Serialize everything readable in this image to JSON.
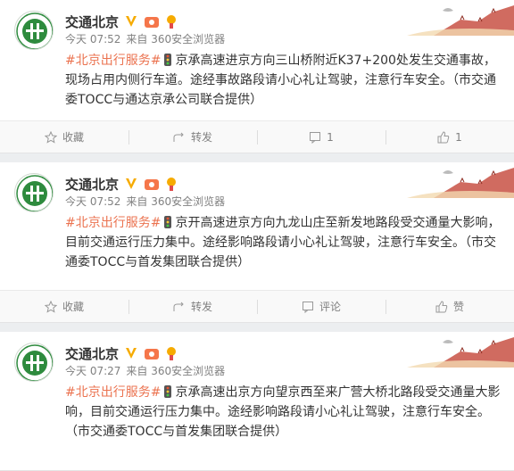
{
  "colors": {
    "accent": "#eb7350",
    "meta": "#808080",
    "verified": "#f6ab00",
    "logo_green": "#2e8b3e"
  },
  "posts": [
    {
      "author": "交通北京",
      "time": "今天 07:52",
      "source": "来自 360安全浏览器",
      "tag": "#北京出行服务#",
      "body": "京承高速进京方向三山桥附近K37+200处发生交通事故，现场占用内侧行车道。途经事故路段请小心礼让驾驶，注意行车安全。（市交通委TOCC与通达京承公司联合提供）",
      "actions": {
        "favorite": "收藏",
        "repost": "转发",
        "comment": "1",
        "like": "1"
      }
    },
    {
      "author": "交通北京",
      "time": "今天 07:52",
      "source": "来自 360安全浏览器",
      "tag": "#北京出行服务#",
      "body": "京开高速进京方向九龙山庄至新发地路段受交通量大影响，目前交通运行压力集中。途经影响路段请小心礼让驾驶，注意行车安全。（市交通委TOCC与首发集团联合提供）",
      "actions": {
        "favorite": "收藏",
        "repost": "转发",
        "comment": "评论",
        "like": "赞"
      }
    },
    {
      "author": "交通北京",
      "time": "今天 07:27",
      "source": "来自 360安全浏览器",
      "tag": "#北京出行服务#",
      "body": "京承高速出京方向望京西至来广营大桥北路段受交通量大影响，目前交通运行压力集中。途经影响路段请小心礼让驾驶，注意行车安全。（市交通委TOCC与首发集团联合提供）",
      "actions": null
    }
  ]
}
